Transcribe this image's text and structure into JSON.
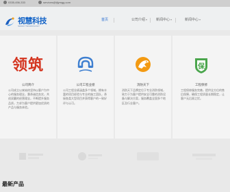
{
  "topbar": {
    "phone": "0335-456-333",
    "email": "services@tjlymgg.com"
  },
  "logo": {
    "title": "视慧科技",
    "subtitle": "SHIHUI TECHNOLOGY"
  },
  "nav": {
    "items": [
      {
        "label": "首页",
        "active": true,
        "dropdown": false
      },
      {
        "label": "公司介绍",
        "active": false,
        "dropdown": true
      },
      {
        "label": "新闻中心",
        "active": false,
        "dropdown": true
      },
      {
        "label": "新闻中心",
        "active": false,
        "dropdown": true
      }
    ]
  },
  "cards": [
    {
      "icon": "lingzhu-logo-icon",
      "icon_text": "领筑",
      "title": "公司简介",
      "desc": "公司成立以来始终坚持以客户为中心的服务理念，秉承诚信务实，共创双赢的经营理念，不断提升服务品质，力求为客户提供更加优质的产品与服务体验。"
    },
    {
      "icon": "horseshoe-magnet-icon",
      "title": "公司工程业绩",
      "desc": "公司工程业绩涵盖多个领域，拥有丰富的项目经验与专业的施工团队，承接各类大型项目并获得客户的一致好评与认可。"
    },
    {
      "icon": "horse-badge-icon",
      "title": "消防天下",
      "desc": "消防天下品牌定位于专业消防领域，致力于为客户提供安全可靠的消防设备与解决方案，服务覆盖全国多个地区及行业客户。"
    },
    {
      "icon": "bao-shield-icon",
      "icon_text": "保",
      "title": "工程保修",
      "desc": "工程保修服务完善，提供全方位的售后保障，确保工程质量长期稳定，让客户无后顾之忧。"
    }
  ],
  "section": {
    "title": "最新产品"
  },
  "colors": {
    "accent": "#2c6fd1",
    "lingzhu_red": "#d4341f",
    "magnet_blue": "#3e7fd0",
    "badge_orange": "#f39a12",
    "shield_green": "#4aa54c"
  }
}
